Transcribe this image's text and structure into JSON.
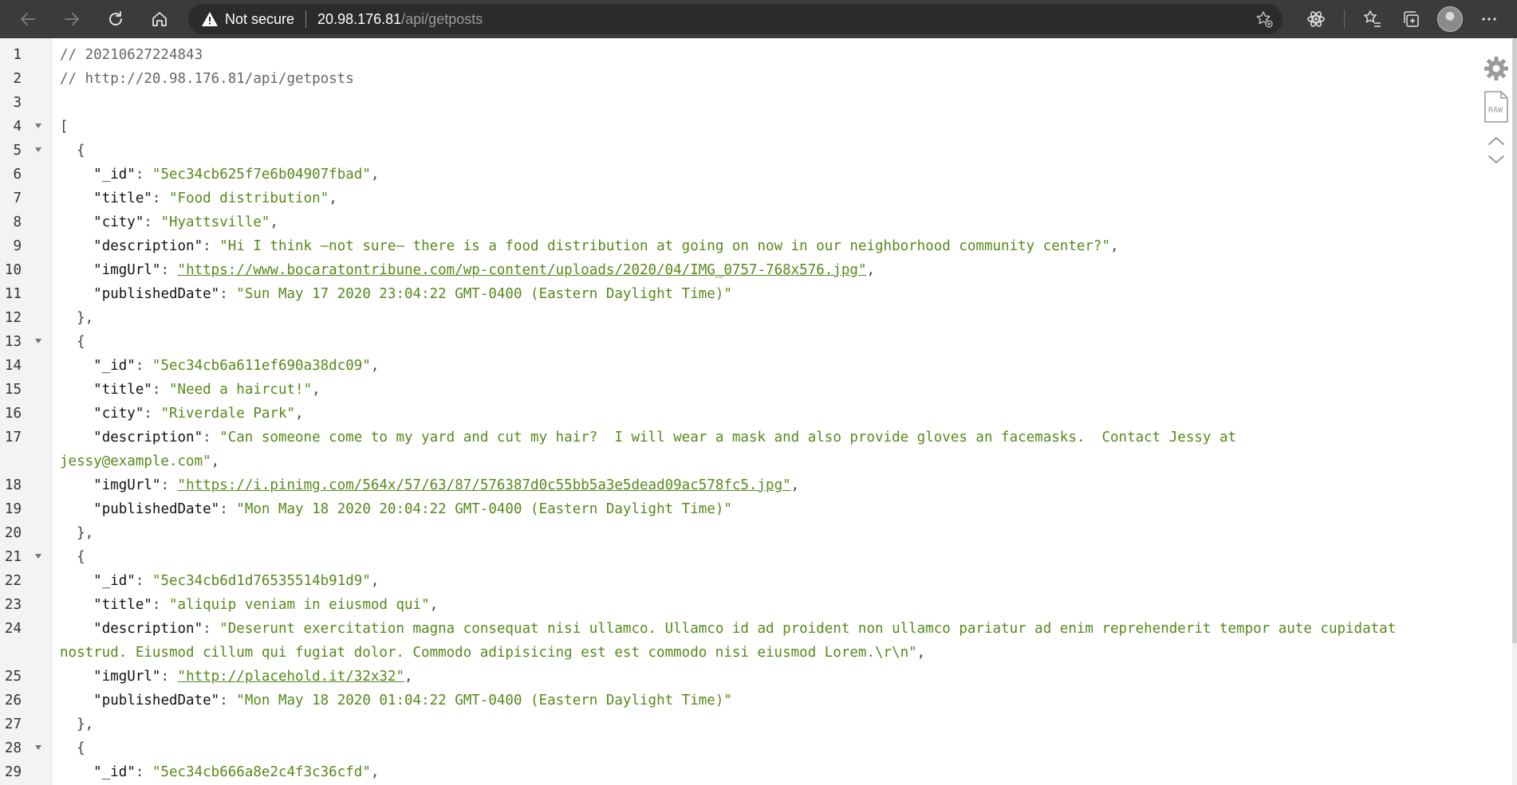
{
  "browser": {
    "security_label": "Not secure",
    "url_host": "20.98.176.81",
    "url_path": "/api/getposts"
  },
  "json_view": {
    "lines": [
      {
        "n": "1",
        "fold": false,
        "parts": [
          {
            "c": "cm",
            "t": "// 20210627224843"
          }
        ]
      },
      {
        "n": "2",
        "fold": false,
        "parts": [
          {
            "c": "cm",
            "t": "// http://20.98.176.81/api/getposts"
          }
        ]
      },
      {
        "n": "3",
        "fold": false,
        "parts": []
      },
      {
        "n": "4",
        "fold": true,
        "parts": [
          {
            "c": "p",
            "t": "["
          }
        ]
      },
      {
        "n": "5",
        "fold": true,
        "parts": [
          {
            "c": "p",
            "t": "  {"
          }
        ]
      },
      {
        "n": "6",
        "fold": false,
        "parts": [
          {
            "c": "k",
            "t": "    \"_id\""
          },
          {
            "c": "p",
            "t": ": "
          },
          {
            "c": "s",
            "t": "\"5ec34cb625f7e6b04907fbad\""
          },
          {
            "c": "p",
            "t": ","
          }
        ]
      },
      {
        "n": "7",
        "fold": false,
        "parts": [
          {
            "c": "k",
            "t": "    \"title\""
          },
          {
            "c": "p",
            "t": ": "
          },
          {
            "c": "s",
            "t": "\"Food distribution\""
          },
          {
            "c": "p",
            "t": ","
          }
        ]
      },
      {
        "n": "8",
        "fold": false,
        "parts": [
          {
            "c": "k",
            "t": "    \"city\""
          },
          {
            "c": "p",
            "t": ": "
          },
          {
            "c": "s",
            "t": "\"Hyattsville\""
          },
          {
            "c": "p",
            "t": ","
          }
        ]
      },
      {
        "n": "9",
        "fold": false,
        "parts": [
          {
            "c": "k",
            "t": "    \"description\""
          },
          {
            "c": "p",
            "t": ": "
          },
          {
            "c": "s",
            "t": "\"Hi I think —not sure— there is a food distribution at going on now in our neighborhood community center?\""
          },
          {
            "c": "p",
            "t": ","
          }
        ]
      },
      {
        "n": "10",
        "fold": false,
        "parts": [
          {
            "c": "k",
            "t": "    \"imgUrl\""
          },
          {
            "c": "p",
            "t": ": "
          },
          {
            "c": "u",
            "t": "\"https://www.bocaratontribune.com/wp-content/uploads/2020/04/IMG_0757-768x576.jpg\""
          },
          {
            "c": "p",
            "t": ","
          }
        ]
      },
      {
        "n": "11",
        "fold": false,
        "parts": [
          {
            "c": "k",
            "t": "    \"publishedDate\""
          },
          {
            "c": "p",
            "t": ": "
          },
          {
            "c": "s",
            "t": "\"Sun May 17 2020 23:04:22 GMT-0400 (Eastern Daylight Time)\""
          }
        ]
      },
      {
        "n": "12",
        "fold": false,
        "parts": [
          {
            "c": "p",
            "t": "  },"
          }
        ]
      },
      {
        "n": "13",
        "fold": true,
        "parts": [
          {
            "c": "p",
            "t": "  {"
          }
        ]
      },
      {
        "n": "14",
        "fold": false,
        "parts": [
          {
            "c": "k",
            "t": "    \"_id\""
          },
          {
            "c": "p",
            "t": ": "
          },
          {
            "c": "s",
            "t": "\"5ec34cb6a611ef690a38dc09\""
          },
          {
            "c": "p",
            "t": ","
          }
        ]
      },
      {
        "n": "15",
        "fold": false,
        "parts": [
          {
            "c": "k",
            "t": "    \"title\""
          },
          {
            "c": "p",
            "t": ": "
          },
          {
            "c": "s",
            "t": "\"Need a haircut!\""
          },
          {
            "c": "p",
            "t": ","
          }
        ]
      },
      {
        "n": "16",
        "fold": false,
        "parts": [
          {
            "c": "k",
            "t": "    \"city\""
          },
          {
            "c": "p",
            "t": ": "
          },
          {
            "c": "s",
            "t": "\"Riverdale Park\""
          },
          {
            "c": "p",
            "t": ","
          }
        ]
      },
      {
        "n": "17",
        "fold": false,
        "parts": [
          {
            "c": "k",
            "t": "    \"description\""
          },
          {
            "c": "p",
            "t": ": "
          },
          {
            "c": "s",
            "t": "\"Can someone come to my yard and cut my hair?  I will wear a mask and also provide gloves an facemasks.  Contact Jessy at jessy@example.com\""
          },
          {
            "c": "p",
            "t": ","
          }
        ]
      },
      {
        "n": "18",
        "fold": false,
        "parts": [
          {
            "c": "k",
            "t": "    \"imgUrl\""
          },
          {
            "c": "p",
            "t": ": "
          },
          {
            "c": "u",
            "t": "\"https://i.pinimg.com/564x/57/63/87/576387d0c55bb5a3e5dead09ac578fc5.jpg\""
          },
          {
            "c": "p",
            "t": ","
          }
        ]
      },
      {
        "n": "19",
        "fold": false,
        "parts": [
          {
            "c": "k",
            "t": "    \"publishedDate\""
          },
          {
            "c": "p",
            "t": ": "
          },
          {
            "c": "s",
            "t": "\"Mon May 18 2020 20:04:22 GMT-0400 (Eastern Daylight Time)\""
          }
        ]
      },
      {
        "n": "20",
        "fold": false,
        "parts": [
          {
            "c": "p",
            "t": "  },"
          }
        ]
      },
      {
        "n": "21",
        "fold": true,
        "parts": [
          {
            "c": "p",
            "t": "  {"
          }
        ]
      },
      {
        "n": "22",
        "fold": false,
        "parts": [
          {
            "c": "k",
            "t": "    \"_id\""
          },
          {
            "c": "p",
            "t": ": "
          },
          {
            "c": "s",
            "t": "\"5ec34cb6d1d76535514b91d9\""
          },
          {
            "c": "p",
            "t": ","
          }
        ]
      },
      {
        "n": "23",
        "fold": false,
        "parts": [
          {
            "c": "k",
            "t": "    \"title\""
          },
          {
            "c": "p",
            "t": ": "
          },
          {
            "c": "s",
            "t": "\"aliquip veniam in eiusmod qui\""
          },
          {
            "c": "p",
            "t": ","
          }
        ]
      },
      {
        "n": "24",
        "fold": false,
        "parts": [
          {
            "c": "k",
            "t": "    \"description\""
          },
          {
            "c": "p",
            "t": ": "
          },
          {
            "c": "s",
            "t": "\"Deserunt exercitation magna consequat nisi ullamco. Ullamco id ad proident non ullamco pariatur ad enim reprehenderit tempor aute cupidatat nostrud. Eiusmod cillum qui fugiat dolor. Commodo adipisicing est est commodo nisi eiusmod Lorem.\\r\\n\""
          },
          {
            "c": "p",
            "t": ","
          }
        ]
      },
      {
        "n": "25",
        "fold": false,
        "parts": [
          {
            "c": "k",
            "t": "    \"imgUrl\""
          },
          {
            "c": "p",
            "t": ": "
          },
          {
            "c": "u",
            "t": "\"http://placehold.it/32x32\""
          },
          {
            "c": "p",
            "t": ","
          }
        ]
      },
      {
        "n": "26",
        "fold": false,
        "parts": [
          {
            "c": "k",
            "t": "    \"publishedDate\""
          },
          {
            "c": "p",
            "t": ": "
          },
          {
            "c": "s",
            "t": "\"Mon May 18 2020 01:04:22 GMT-0400 (Eastern Daylight Time)\""
          }
        ]
      },
      {
        "n": "27",
        "fold": false,
        "parts": [
          {
            "c": "p",
            "t": "  },"
          }
        ]
      },
      {
        "n": "28",
        "fold": true,
        "parts": [
          {
            "c": "p",
            "t": "  {"
          }
        ]
      },
      {
        "n": "29",
        "fold": false,
        "parts": [
          {
            "c": "k",
            "t": "    \"_id\""
          },
          {
            "c": "p",
            "t": ": "
          },
          {
            "c": "s",
            "t": "\"5ec34cb666a8e2c4f3c36cfd\""
          },
          {
            "c": "p",
            "t": ","
          }
        ]
      }
    ]
  },
  "side_tools": {
    "raw_label": "RAW"
  },
  "icons": {
    "back": "arrow-left-icon",
    "forward": "arrow-right-icon",
    "refresh": "refresh-icon",
    "home": "home-icon",
    "warning": "warning-triangle-icon",
    "add_favorite": "star-plus-icon",
    "extension": "atom-icon",
    "favorites": "star-list-icon",
    "collections": "collections-icon",
    "more": "ellipsis-icon",
    "settings": "gear-icon",
    "raw": "raw-file-icon",
    "collapse": "chevron-up-icon",
    "expand": "chevron-down-icon"
  },
  "colors": {
    "toolbar_bg": "#3b3b3b",
    "address_bg": "#2b2b2b",
    "string_green": "#56891a",
    "gutter_bg": "#f3f3f3"
  }
}
